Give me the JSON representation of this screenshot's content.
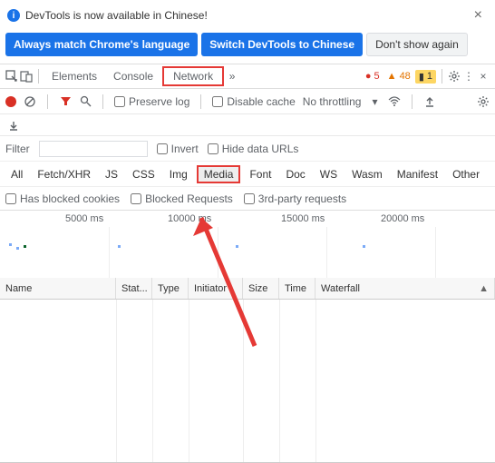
{
  "banner": {
    "text": "DevTools is now available in Chinese!",
    "btn_match": "Always match Chrome's language",
    "btn_switch": "Switch DevTools to Chinese",
    "btn_dont": "Don't show again"
  },
  "tabs": {
    "elements": "Elements",
    "console": "Console",
    "network": "Network"
  },
  "status": {
    "errors": "5",
    "warnings": "48",
    "messages": "1"
  },
  "toolbar": {
    "preserve_log": "Preserve log",
    "disable_cache": "Disable cache",
    "no_throttling": "No throttling"
  },
  "filter": {
    "label": "Filter",
    "value": "",
    "invert": "Invert",
    "hide_data": "Hide data URLs"
  },
  "types": {
    "all": "All",
    "fetch": "Fetch/XHR",
    "js": "JS",
    "css": "CSS",
    "img": "Img",
    "media": "Media",
    "font": "Font",
    "doc": "Doc",
    "ws": "WS",
    "wasm": "Wasm",
    "manifest": "Manifest",
    "other": "Other"
  },
  "extra": {
    "blocked_cookies": "Has blocked cookies",
    "blocked_requests": "Blocked Requests",
    "third_party": "3rd-party requests"
  },
  "timeline": {
    "t1": "5000 ms",
    "t2": "10000 ms",
    "t3": "15000 ms",
    "t4": "20000 ms"
  },
  "grid": {
    "name": "Name",
    "status": "Stat...",
    "type": "Type",
    "initiator": "Initiator",
    "size": "Size",
    "time": "Time",
    "waterfall": "Waterfall"
  }
}
